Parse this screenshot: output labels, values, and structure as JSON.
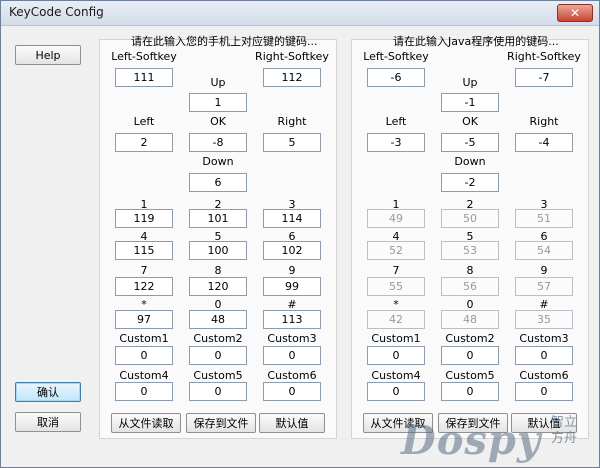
{
  "window": {
    "title": "KeyCode Config",
    "close_glyph": "✕"
  },
  "side": {
    "help": "Help",
    "confirm": "确认",
    "cancel": "取消"
  },
  "phone": {
    "header": "请在此输入您的手机上对应键的键码...",
    "left_softkey": {
      "label": "Left-Softkey",
      "value": "111"
    },
    "right_softkey": {
      "label": "Right-Softkey",
      "value": "112"
    },
    "up": {
      "label": "Up",
      "value": "1"
    },
    "left": {
      "label": "Left",
      "value": "2"
    },
    "ok": {
      "label": "OK",
      "value": "-8"
    },
    "right": {
      "label": "Right",
      "value": "5"
    },
    "down": {
      "label": "Down",
      "value": "6"
    },
    "keys": [
      {
        "label": "1",
        "value": "119"
      },
      {
        "label": "2",
        "value": "101"
      },
      {
        "label": "3",
        "value": "114"
      },
      {
        "label": "4",
        "value": "115"
      },
      {
        "label": "5",
        "value": "100"
      },
      {
        "label": "6",
        "value": "102"
      },
      {
        "label": "7",
        "value": "122"
      },
      {
        "label": "8",
        "value": "120"
      },
      {
        "label": "9",
        "value": "99"
      },
      {
        "label": "*",
        "value": "97"
      },
      {
        "label": "0",
        "value": "48"
      },
      {
        "label": "#",
        "value": "113"
      },
      {
        "label": "Custom1",
        "value": "0"
      },
      {
        "label": "Custom2",
        "value": "0"
      },
      {
        "label": "Custom3",
        "value": "0"
      },
      {
        "label": "Custom4",
        "value": "0"
      },
      {
        "label": "Custom5",
        "value": "0"
      },
      {
        "label": "Custom6",
        "value": "0"
      }
    ],
    "buttons": {
      "load": "从文件读取",
      "save": "保存到文件",
      "default": "默认值"
    }
  },
  "java": {
    "header": "请在此输入Java程序使用的键码...",
    "left_softkey": {
      "label": "Left-Softkey",
      "value": "-6"
    },
    "right_softkey": {
      "label": "Right-Softkey",
      "value": "-7"
    },
    "up": {
      "label": "Up",
      "value": "-1"
    },
    "left": {
      "label": "Left",
      "value": "-3"
    },
    "ok": {
      "label": "OK",
      "value": "-5"
    },
    "right": {
      "label": "Right",
      "value": "-4"
    },
    "down": {
      "label": "Down",
      "value": "-2"
    },
    "keys": [
      {
        "label": "1",
        "value": "49"
      },
      {
        "label": "2",
        "value": "50"
      },
      {
        "label": "3",
        "value": "51"
      },
      {
        "label": "4",
        "value": "52"
      },
      {
        "label": "5",
        "value": "53"
      },
      {
        "label": "6",
        "value": "54"
      },
      {
        "label": "7",
        "value": "55"
      },
      {
        "label": "8",
        "value": "56"
      },
      {
        "label": "9",
        "value": "57"
      },
      {
        "label": "*",
        "value": "42"
      },
      {
        "label": "0",
        "value": "48"
      },
      {
        "label": "#",
        "value": "35"
      },
      {
        "label": "Custom1",
        "value": "0"
      },
      {
        "label": "Custom2",
        "value": "0"
      },
      {
        "label": "Custom3",
        "value": "0"
      },
      {
        "label": "Custom4",
        "value": "0"
      },
      {
        "label": "Custom5",
        "value": "0"
      },
      {
        "label": "Custom6",
        "value": "0"
      }
    ],
    "buttons": {
      "load": "从文件读取",
      "save": "保存到文件",
      "default": "默认值"
    }
  },
  "watermark": {
    "brand": "Dospy",
    "sub1": "智立",
    "sub2": "方舟"
  }
}
